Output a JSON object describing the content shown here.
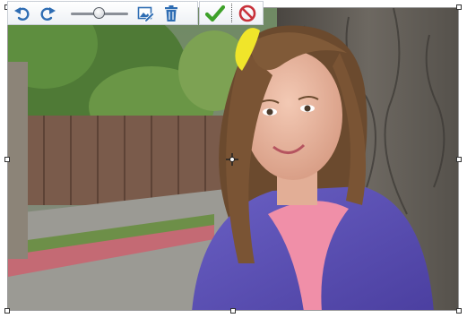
{
  "toolbar": {
    "buttons": [
      {
        "name": "rotate-left",
        "icon": "rotate-left-icon"
      },
      {
        "name": "rotate-right",
        "icon": "rotate-right-icon"
      },
      {
        "name": "edit-image",
        "icon": "edit-image-icon"
      },
      {
        "name": "delete",
        "icon": "trash-icon"
      }
    ],
    "zoom_slider": {
      "value": 0.5
    }
  },
  "confirm": {
    "accept_icon": "checkmark-icon",
    "cancel_icon": "no-entry-icon"
  },
  "colors": {
    "accent_blue": "#2f6db3",
    "accept_green": "#3ea12a",
    "cancel_red": "#c8313a"
  }
}
